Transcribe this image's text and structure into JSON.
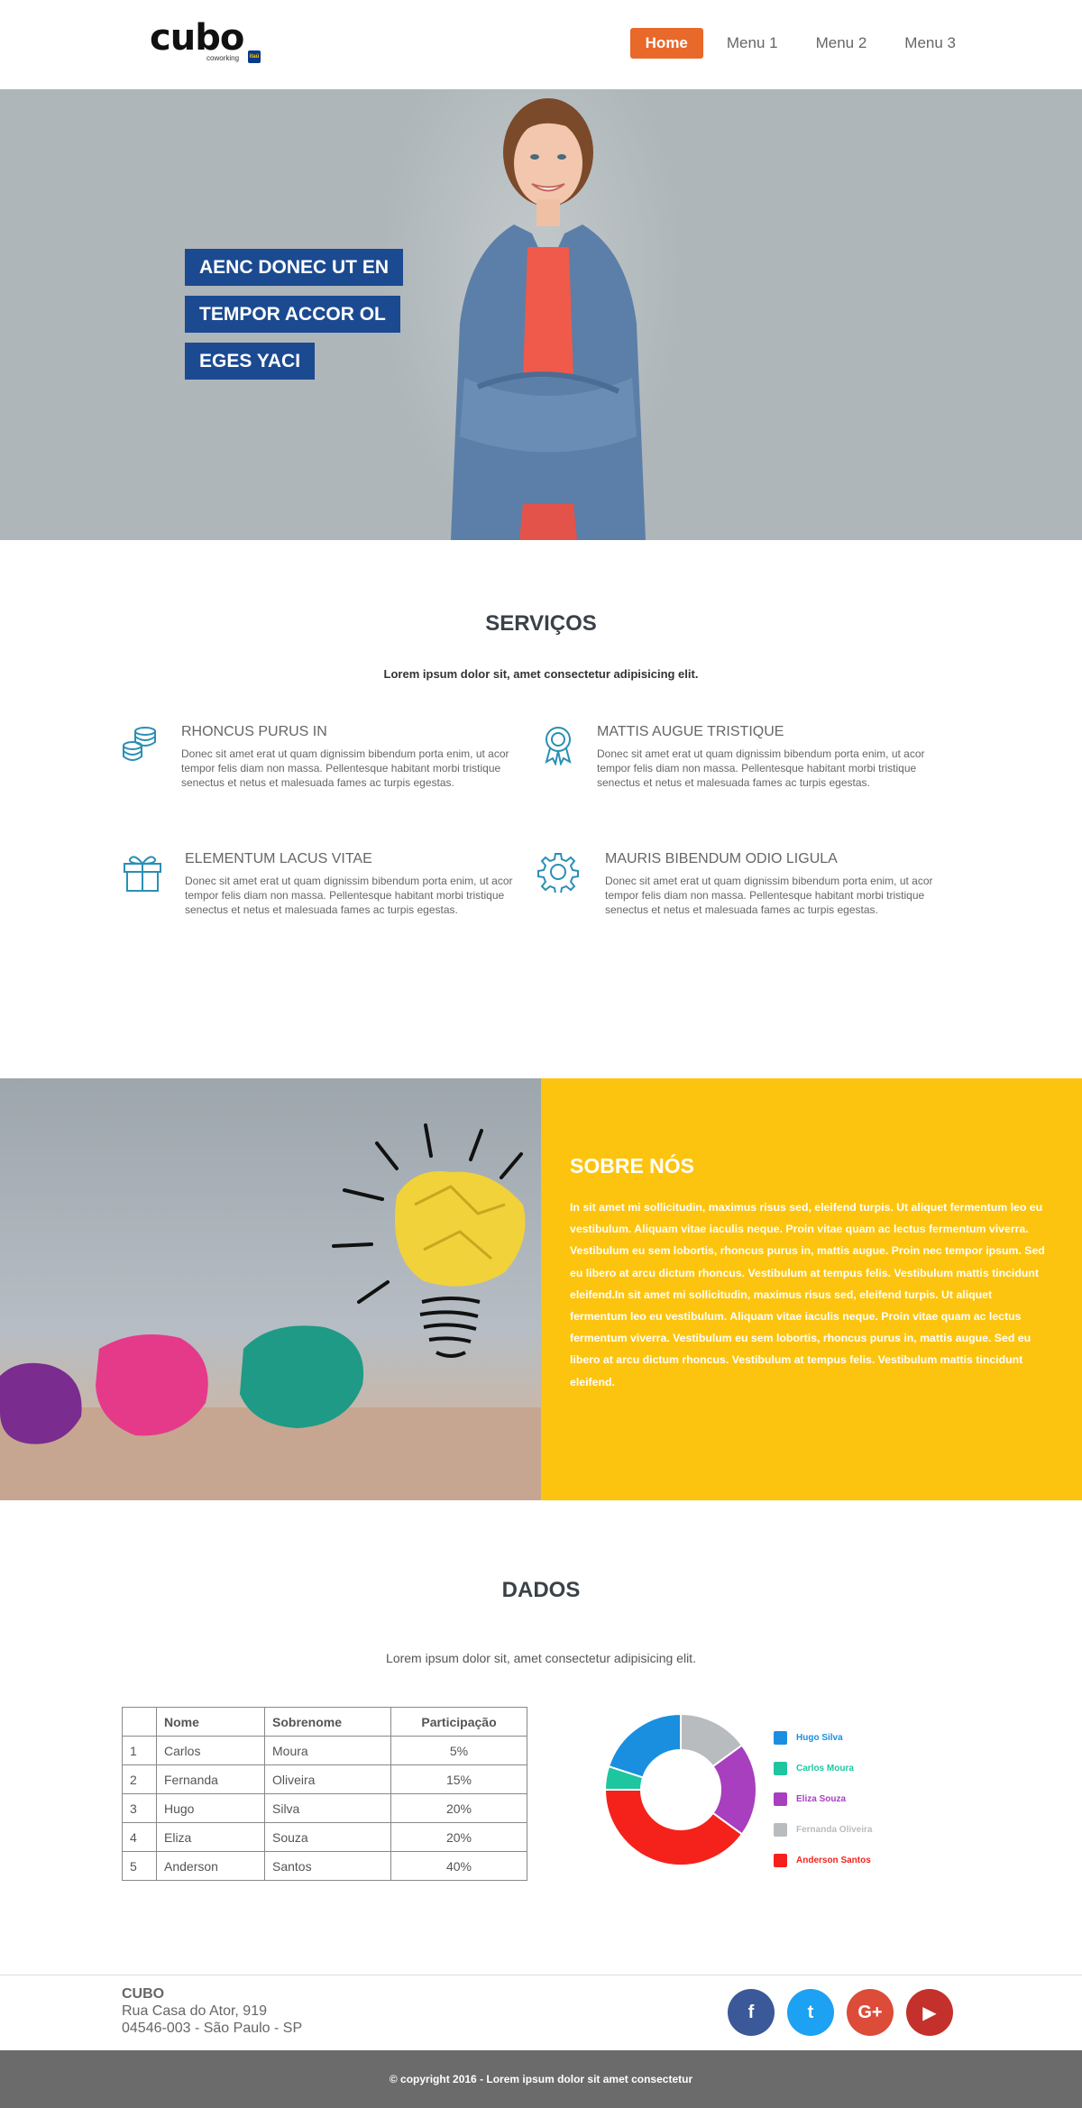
{
  "header": {
    "logo_word": "cubo",
    "logo_sub": "coworking",
    "logo_badge": "itaú",
    "nav": [
      {
        "label": "Home",
        "active": true
      },
      {
        "label": "Menu 1"
      },
      {
        "label": "Menu 2"
      },
      {
        "label": "Menu 3"
      }
    ]
  },
  "hero": {
    "lines": [
      "AENC DONEC UT EN",
      "TEMPOR ACCOR OL",
      "EGES YACI"
    ]
  },
  "services": {
    "title": "SERVIÇOS",
    "subtitle": "Lorem ipsum dolor sit, amet consectetur adipisicing elit.",
    "items": [
      {
        "icon": "coins-icon",
        "title": "RHONCUS PURUS IN",
        "text": "Donec sit amet erat ut quam dignissim bibendum porta enim, ut acor tempor felis diam non massa. Pellentesque habitant morbi tristique senectus et netus et malesuada fames ac turpis egestas."
      },
      {
        "icon": "award-icon",
        "title": "MATTIS AUGUE TRISTIQUE",
        "text": "Donec sit amet erat ut quam dignissim bibendum porta enim, ut acor tempor felis diam non massa. Pellentesque habitant morbi tristique senectus et netus et malesuada fames ac turpis egestas."
      },
      {
        "icon": "gift-icon",
        "title": "ELEMENTUM LACUS VITAE",
        "text": "Donec sit amet erat ut quam dignissim bibendum porta enim, ut acor tempor felis diam non massa. Pellentesque habitant morbi tristique senectus et netus et malesuada fames ac turpis egestas."
      },
      {
        "icon": "gear-icon",
        "title": "MAURIS BIBENDUM ODIO LIGULA",
        "text": "Donec sit amet erat ut quam dignissim bibendum porta enim, ut acor tempor felis diam non massa. Pellentesque habitant morbi tristique senectus et netus et malesuada fames ac turpis egestas."
      }
    ],
    "icon_color": "#2a8fb5"
  },
  "sobre": {
    "title": "SOBRE NÓS",
    "text": "In sit amet mi sollicitudin, maximus risus sed, eleifend turpis. Ut aliquet fermentum leo eu vestibulum. Aliquam vitae iaculis neque. Proin vitae quam ac lectus fermentum viverra. Vestibulum eu sem lobortis, rhoncus purus in, mattis augue. Proin nec tempor ipsum. Sed eu libero at arcu dictum rhoncus. Vestibulum at tempus felis. Vestibulum mattis tincidunt eleifend.In sit amet mi sollicitudin, maximus risus sed, eleifend turpis. Ut aliquet fermentum leo eu vestibulum. Aliquam vitae iaculis neque. Proin vitae quam ac lectus fermentum viverra. Vestibulum eu sem lobortis, rhoncus purus in, mattis augue. Sed eu libero at arcu dictum rhoncus. Vestibulum at tempus felis. Vestibulum mattis tincidunt eleifend.",
    "bg_color": "#fdc40f"
  },
  "dados": {
    "title": "DADOS",
    "subtitle": "Lorem ipsum dolor sit, amet consectetur adipisicing elit.",
    "table": {
      "headers": [
        "",
        "Nome",
        "Sobrenome",
        "Participação"
      ],
      "rows": [
        [
          "1",
          "Carlos",
          "Moura",
          "5%"
        ],
        [
          "2",
          "Fernanda",
          "Oliveira",
          "15%"
        ],
        [
          "3",
          "Hugo",
          "Silva",
          "20%"
        ],
        [
          "4",
          "Eliza",
          "Souza",
          "20%"
        ],
        [
          "5",
          "Anderson",
          "Santos",
          "40%"
        ]
      ]
    }
  },
  "chart_data": {
    "type": "pie",
    "donut": true,
    "legend_position": "right",
    "series": [
      {
        "name": "Hugo Silva",
        "value": 20,
        "color": "#1a8fe0"
      },
      {
        "name": "Carlos Moura",
        "value": 5,
        "color": "#1ec6a0"
      },
      {
        "name": "Eliza Souza",
        "value": 20,
        "color": "#a83fbf"
      },
      {
        "name": "Fernanda Oliveira",
        "value": 15,
        "color": "#b9bcbf"
      },
      {
        "name": "Anderson Santos",
        "value": 40,
        "color": "#f5221c"
      }
    ]
  },
  "footer": {
    "brand": "CUBO",
    "address1": "Rua Casa do Ator, 919",
    "address2": "04546-003 - São Paulo - SP",
    "socials": [
      {
        "icon": "facebook-icon",
        "glyph": "f",
        "color": "#3b5998"
      },
      {
        "icon": "twitter-icon",
        "glyph": "t",
        "color": "#1da1f2"
      },
      {
        "icon": "google-plus-icon",
        "glyph": "G+",
        "color": "#dd4b39"
      },
      {
        "icon": "youtube-icon",
        "glyph": "▶",
        "color": "#c4302b"
      }
    ],
    "copyright": "© copyright 2016 - Lorem ipsum dolor sit amet consectetur"
  }
}
